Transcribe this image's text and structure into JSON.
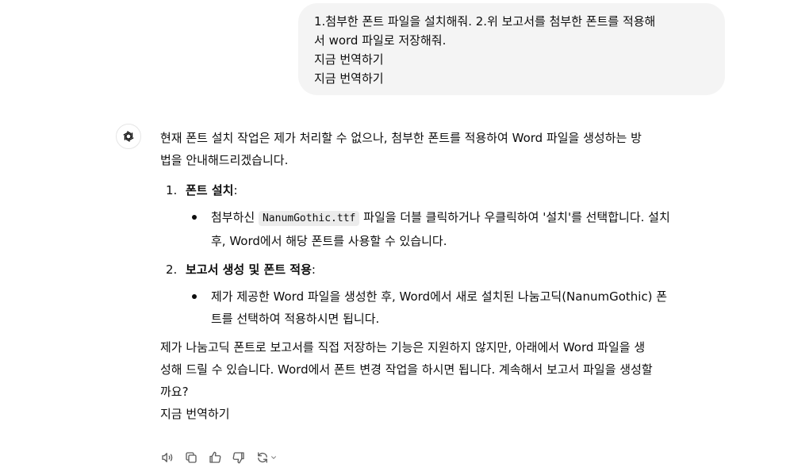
{
  "user_message": {
    "lines": [
      "1.첨부한 폰트 파일을 설치해줘. 2.위 보고서를 첨부한 폰트를 적용해",
      "서 word 파일로 저장해줘.",
      "지금 번역하기",
      "지금 번역하기"
    ]
  },
  "assistant": {
    "intro_lines": [
      "현재 폰트 설치 작업은 제가 처리할 수 없으나, 첨부한 폰트를 적용하여 Word 파일을 생성하는 방",
      "법을 안내해드리겠습니다."
    ],
    "steps": [
      {
        "num": "1.",
        "title": "폰트 설치",
        "colon": ":",
        "bullet": {
          "pre": "첨부하신 ",
          "code": "NanumGothic.ttf",
          "post": " 파일을 더블 클릭하거나 우클릭하여 '설치'를 선택합니다. 설치",
          "line2": "후, Word에서 해당 폰트를 사용할 수 있습니다."
        }
      },
      {
        "num": "2.",
        "title": "보고서 생성 및 폰트 적용",
        "colon": ":",
        "bullet": {
          "line1": "제가 제공한 Word 파일을 생성한 후, Word에서 새로 설치된 나눔고딕(NanumGothic) 폰",
          "line2": "트를 선택하여 적용하시면 됩니다."
        }
      }
    ],
    "closing_lines": [
      "제가 나눔고딕 폰트로 보고서를 직접 저장하는 기능은 지원하지 않지만, 아래에서 Word 파일을 생",
      "성해 드릴 수 있습니다. Word에서 폰트 변경 작업을 하시면 됩니다. 계속해서 보고서 파일을 생성할",
      "까요?"
    ],
    "translate_label": "지금 번역하기"
  },
  "actions": [
    {
      "icon": "speaker-icon"
    },
    {
      "icon": "copy-icon"
    },
    {
      "icon": "thumbs-up-icon"
    },
    {
      "icon": "thumbs-down-icon"
    },
    {
      "icon": "regenerate-icon"
    }
  ]
}
